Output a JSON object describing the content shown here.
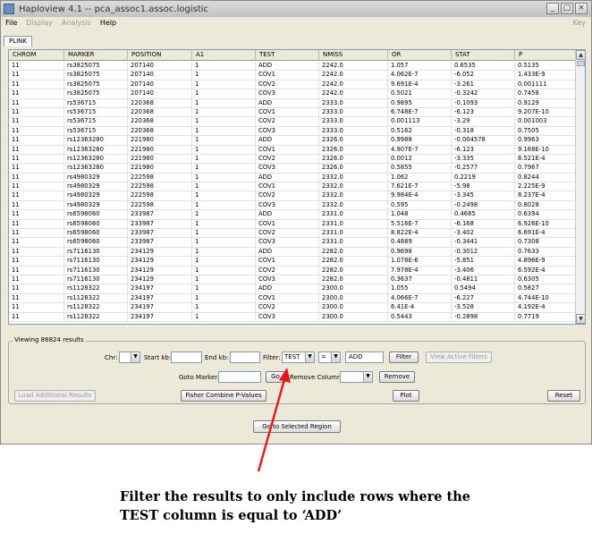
{
  "window": {
    "title": "Haploview 4.1 -- pca_assoc1.assoc.logistic",
    "controls": [
      "_",
      "□",
      "×"
    ]
  },
  "menubar": {
    "items": [
      {
        "label": "File",
        "enabled": true
      },
      {
        "label": "Display",
        "enabled": false
      },
      {
        "label": "Analysis",
        "enabled": false
      },
      {
        "label": "Help",
        "enabled": true
      }
    ],
    "key_label": "Key"
  },
  "tab": {
    "label": "PLINK"
  },
  "table": {
    "columns": [
      "CHROM",
      "MARKER",
      "POSITION",
      "A1",
      "TEST",
      "NMISS",
      "OR",
      "STAT",
      "P"
    ],
    "rows": [
      [
        "11",
        "rs3825075",
        "207140",
        "1",
        "ADD",
        "2242.0",
        "1.057",
        "0.6535",
        "0.5135"
      ],
      [
        "11",
        "rs3825075",
        "207140",
        "1",
        "COV1",
        "2242.0",
        "4.062E-7",
        "-6.052",
        "1.433E-9"
      ],
      [
        "11",
        "rs3825075",
        "207140",
        "1",
        "COV2",
        "2242.0",
        "9.691E-4",
        "-3.261",
        "0.001111"
      ],
      [
        "11",
        "rs3825075",
        "207140",
        "1",
        "COV3",
        "2242.0",
        "0.5021",
        "-0.3242",
        "0.7458"
      ],
      [
        "11",
        "rs536715",
        "220368",
        "1",
        "ADD",
        "2333.0",
        "0.9895",
        "-0.1093",
        "0.9129"
      ],
      [
        "11",
        "rs536715",
        "220368",
        "1",
        "COV1",
        "2333.0",
        "6.748E-7",
        "-6.123",
        "9.207E-10"
      ],
      [
        "11",
        "rs536715",
        "220368",
        "1",
        "COV2",
        "2333.0",
        "0.001113",
        "-3.29",
        "0.001003"
      ],
      [
        "11",
        "rs536715",
        "220368",
        "1",
        "COV3",
        "2333.0",
        "0.5162",
        "-0.318",
        "0.7505"
      ],
      [
        "11",
        "rs12363280",
        "221980",
        "1",
        "ADD",
        "2326.0",
        "0.9988",
        "-0.004578",
        "0.9963"
      ],
      [
        "11",
        "rs12363280",
        "221980",
        "1",
        "COV1",
        "2326.0",
        "4.907E-7",
        "-6.123",
        "9.168E-10"
      ],
      [
        "11",
        "rs12363280",
        "221980",
        "1",
        "COV2",
        "2326.0",
        "0.0012",
        "-3.335",
        "8.521E-4"
      ],
      [
        "11",
        "rs12363280",
        "221980",
        "1",
        "COV3",
        "2326.0",
        "0.5855",
        "-0.2577",
        "0.7967"
      ],
      [
        "11",
        "rs4980329",
        "222598",
        "1",
        "ADD",
        "2332.0",
        "1.062",
        "0.2219",
        "0.8244"
      ],
      [
        "11",
        "rs4980329",
        "222598",
        "1",
        "COV1",
        "2332.0",
        "7.621E-7",
        "-5.98",
        "2.225E-9"
      ],
      [
        "11",
        "rs4980329",
        "222598",
        "1",
        "COV2",
        "2332.0",
        "9.984E-4",
        "-3.345",
        "8.237E-4"
      ],
      [
        "11",
        "rs4980329",
        "222598",
        "1",
        "COV3",
        "2332.0",
        "0.595",
        "-0.2498",
        "0.8028"
      ],
      [
        "11",
        "rs6598060",
        "233987",
        "1",
        "ADD",
        "2331.0",
        "1.048",
        "0.4685",
        "0.6394"
      ],
      [
        "11",
        "rs6598060",
        "233987",
        "1",
        "COV1",
        "2331.0",
        "5.516E-7",
        "-6.168",
        "6.926E-10"
      ],
      [
        "11",
        "rs6598060",
        "233987",
        "1",
        "COV2",
        "2331.0",
        "8.822E-4",
        "-3.402",
        "6.691E-4"
      ],
      [
        "11",
        "rs6598060",
        "233987",
        "1",
        "COV3",
        "2331.0",
        "0.4889",
        "-0.3441",
        "0.7308"
      ],
      [
        "11",
        "rs7116130",
        "234129",
        "1",
        "ADD",
        "2282.0",
        "0.9698",
        "-0.3012",
        "0.7633"
      ],
      [
        "11",
        "rs7116130",
        "234129",
        "1",
        "COV1",
        "2282.0",
        "1.078E-6",
        "-5.851",
        "4.896E-9"
      ],
      [
        "11",
        "rs7116130",
        "234129",
        "1",
        "COV2",
        "2282.0",
        "7.978E-4",
        "-3.406",
        "6.592E-4"
      ],
      [
        "11",
        "rs7116130",
        "234129",
        "1",
        "COV3",
        "2282.0",
        "0.3637",
        "-0.4811",
        "0.6305"
      ],
      [
        "11",
        "rs1128322",
        "234197",
        "1",
        "ADD",
        "2300.0",
        "1.055",
        "0.5494",
        "0.5827"
      ],
      [
        "11",
        "rs1128322",
        "234197",
        "1",
        "COV1",
        "2300.0",
        "4.066E-7",
        "-6.227",
        "4.744E-10"
      ],
      [
        "11",
        "rs1128322",
        "234197",
        "1",
        "COV2",
        "2300.0",
        "6.41E-4",
        "-3.528",
        "4.192E-4"
      ],
      [
        "11",
        "rs1128322",
        "234197",
        "1",
        "COV3",
        "2300.0",
        "0.5443",
        "-0.2898",
        "0.7719"
      ]
    ]
  },
  "results": {
    "legend": "Viewing 86824 results",
    "chr_label": "Chr:",
    "start_label": "Start kb:",
    "end_label": "End kb:",
    "filter_label": "Filter:",
    "filter_column": "TEST",
    "filter_operator": "=",
    "filter_value": "ADD",
    "filter_button": "Filter",
    "view_filters_button": "View Active Filters",
    "goto_marker_label": "Goto Marker:",
    "go_button": "Go",
    "remove_column_label": "Remove Column:",
    "remove_button": "Remove",
    "load_button": "Load Additional Results",
    "fisher_button": "Fisher Combine P-Values",
    "plot_button": "Plot",
    "reset_button": "Reset"
  },
  "goto_region_button": "Go to Selected Region",
  "annotation": {
    "line1": "Filter the results to only include rows where the",
    "line2": "TEST column is equal to ‘ADD’",
    "arrow_color": "#e8161c"
  }
}
